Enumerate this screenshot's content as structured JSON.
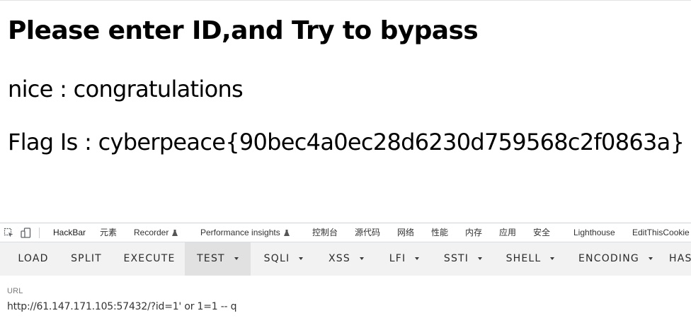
{
  "page": {
    "heading": "Please enter ID,and Try to bypass",
    "message": "nice : congratulations",
    "flag_line": "Flag Is : cyberpeace{90bec4a0ec28d6230d759568c2f0863a}"
  },
  "devtools": {
    "tabs": [
      {
        "label": "HackBar",
        "active": true
      },
      {
        "label": "元素"
      },
      {
        "label": "Recorder",
        "icon": "flask-icon"
      },
      {
        "label": "Performance insights",
        "icon": "flask-icon"
      },
      {
        "label": "控制台"
      },
      {
        "label": "源代码"
      },
      {
        "label": "网络"
      },
      {
        "label": "性能"
      },
      {
        "label": "内存"
      },
      {
        "label": "应用"
      },
      {
        "label": "安全"
      },
      {
        "label": "Lighthouse"
      },
      {
        "label": "EditThisCookie"
      }
    ]
  },
  "hackbar": {
    "buttons": [
      {
        "label": "LOAD"
      },
      {
        "label": "SPLIT"
      },
      {
        "label": "EXECUTE"
      },
      {
        "label": "TEST",
        "dropdown": true,
        "selected": true
      },
      {
        "label": "SQLI",
        "dropdown": true
      },
      {
        "label": "XSS",
        "dropdown": true
      },
      {
        "label": "LFI",
        "dropdown": true
      },
      {
        "label": "SSTI",
        "dropdown": true
      },
      {
        "label": "SHELL",
        "dropdown": true
      },
      {
        "label": "ENCODING",
        "dropdown": true
      },
      {
        "label": "HAS"
      }
    ],
    "url_label": "URL",
    "url_value": "http://61.147.171.105:57432/?id=1' or 1=1 -- q"
  },
  "colors": {
    "active_tab_underline": "#1a73e8",
    "toolbar_bg": "#f2f2f2",
    "selected_button_bg": "#e1e1e1"
  }
}
